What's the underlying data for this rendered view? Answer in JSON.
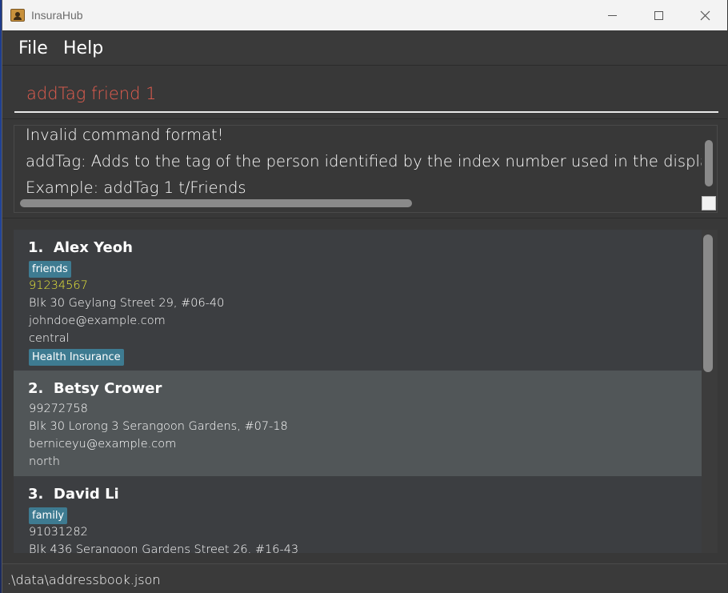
{
  "window": {
    "title": "InsuraHub",
    "icon": "address-book-icon"
  },
  "menu": {
    "file": "File",
    "help": "Help"
  },
  "command": {
    "value": "addTag friend 1",
    "text_color": "#e35d4f"
  },
  "result": {
    "lines": [
      "Invalid command format!",
      "addTag: Adds to the tag of the person identified by the index number used in the displayed person list.",
      "Example: addTag 1 t/Friends"
    ]
  },
  "persons": [
    {
      "index": "1.",
      "name": "Alex Yeoh",
      "tags": [
        "friends"
      ],
      "phone": "91234567",
      "address": "Blk 30 Geylang Street 29, #06-40",
      "email": "johndoe@example.com",
      "region": "central",
      "insurance": [
        "Health Insurance"
      ]
    },
    {
      "index": "2.",
      "name": "Betsy Crower",
      "tags": [],
      "phone": "99272758",
      "address": "Blk 30 Lorong 3 Serangoon Gardens, #07-18",
      "email": "berniceyu@example.com",
      "region": "north",
      "insurance": []
    },
    {
      "index": "3.",
      "name": "David Li",
      "tags": [
        "family"
      ],
      "phone": "91031282",
      "address": "Blk 436 Serangoon Gardens Street 26, #16-43",
      "email": "",
      "region": "",
      "insurance": []
    }
  ],
  "status": {
    "path": ".\\data\\addressbook.json"
  },
  "colors": {
    "tag_bg": "#3e7b91",
    "selected_card": "#515658",
    "phone_highlight": "#e8e83a"
  }
}
